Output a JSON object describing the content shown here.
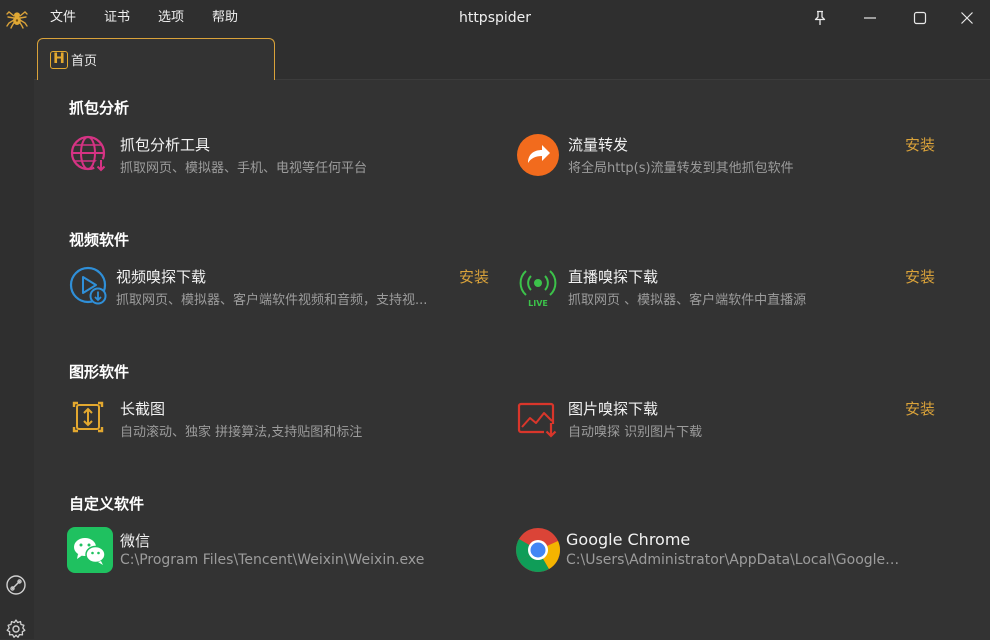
{
  "window": {
    "title": "httpspider"
  },
  "menu": [
    "文件",
    "证书",
    "选项",
    "帮助"
  ],
  "tab": {
    "label": "首页",
    "logo_letter": "H"
  },
  "colors": {
    "accent": "#d9a23a",
    "background": "#333333",
    "chrome": "#2f2f2f"
  },
  "sections": [
    {
      "title": "抓包分析",
      "items": [
        {
          "name": "抓包分析工具",
          "desc": "抓取网页、模拟器、手机、电视等任何平台",
          "icon": "globe-download-icon",
          "install": ""
        },
        {
          "name": "流量转发",
          "desc": "将全局http(s)流量转发到其他抓包软件",
          "icon": "forward-arrow-icon",
          "install": "安装"
        }
      ]
    },
    {
      "title": "视频软件",
      "items": [
        {
          "name": "视频嗅探下载",
          "desc": "抓取网页、模拟器、客户端软件视频和音频，支持视...",
          "icon": "video-download-icon",
          "install": "安装"
        },
        {
          "name": "直播嗅探下载",
          "desc": "抓取网页 、模拟器、客户端软件中直播源",
          "icon": "live-broadcast-icon",
          "install": "安装"
        }
      ]
    },
    {
      "title": "图形软件",
      "items": [
        {
          "name": "长截图",
          "desc": "自动滚动、独家 拼接算法,支持贴图和标注",
          "icon": "long-screenshot-icon",
          "install": ""
        },
        {
          "name": "图片嗅探下载",
          "desc": "自动嗅探 识别图片下载",
          "icon": "image-download-icon",
          "install": "安装"
        }
      ]
    },
    {
      "title": "自定义软件",
      "items": [
        {
          "name": "微信",
          "desc": "C:\\Program Files\\Tencent\\Weixin\\Weixin.exe",
          "icon": "wechat-icon",
          "install": ""
        },
        {
          "name": "Google Chrome",
          "desc": "C:\\Users\\Administrator\\AppData\\Local\\Google\\...",
          "icon": "chrome-icon",
          "install": ""
        }
      ]
    }
  ]
}
